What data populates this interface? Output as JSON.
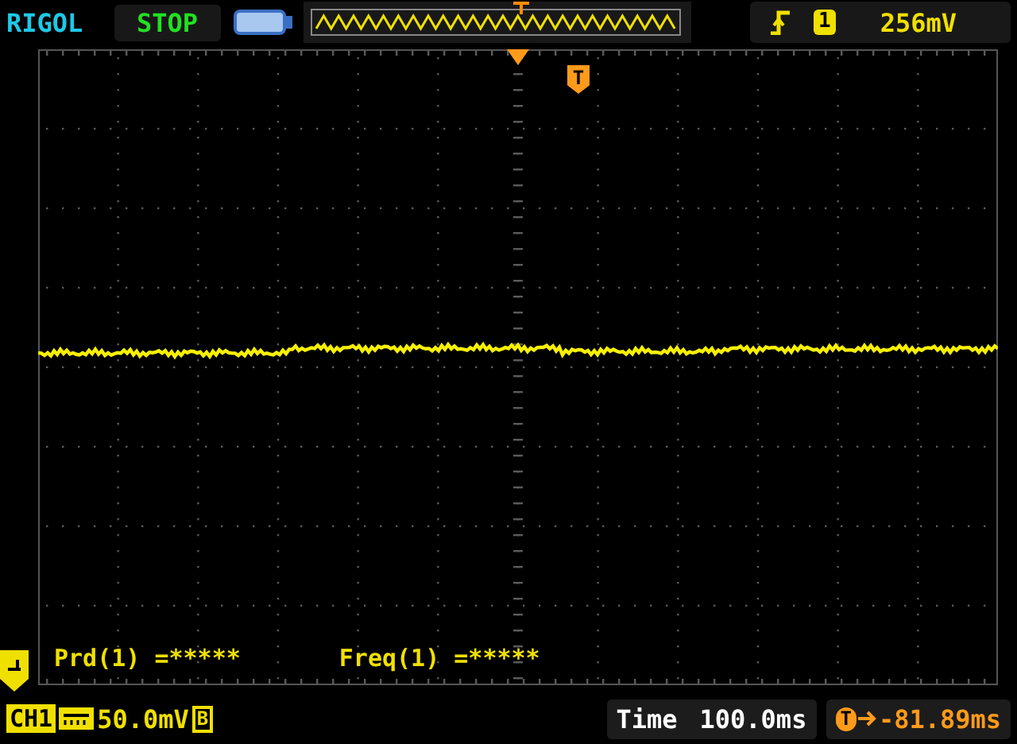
{
  "brand": "RIGOL",
  "run_state": "STOP",
  "trigger": {
    "source": "1",
    "level": "256mV"
  },
  "markers": {
    "trigger_pin": "T",
    "offset_badge": "T"
  },
  "measurements": [
    {
      "label": "Prd(1) =*****"
    },
    {
      "label": "Freq(1) =*****"
    }
  ],
  "channel": {
    "name": "CH1",
    "scale": "50.0mV",
    "bandwidth": "B"
  },
  "timebase": {
    "label": "Time",
    "value": "100.0ms"
  },
  "trigger_offset": "-81.89ms"
}
